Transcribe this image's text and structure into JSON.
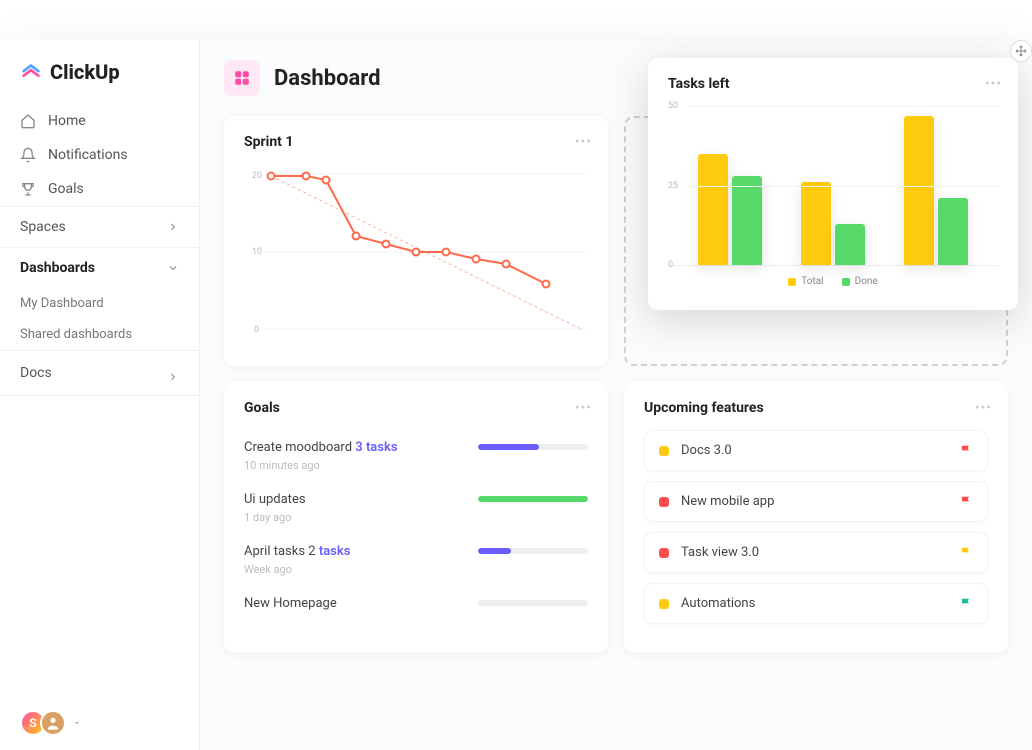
{
  "brand": "ClickUp",
  "nav": {
    "home": "Home",
    "notifications": "Notifications",
    "goals": "Goals"
  },
  "sections": {
    "spaces": "Spaces",
    "dashboards": "Dashboards",
    "docs": "Docs"
  },
  "dashboards_sub": {
    "my": "My Dashboard",
    "shared": "Shared dashboards"
  },
  "page": {
    "title": "Dashboard"
  },
  "sprint": {
    "title": "Sprint 1"
  },
  "tasks_left": {
    "title": "Tasks left",
    "legend_total": "Total",
    "legend_done": "Done"
  },
  "goals_card": {
    "title": "Goals",
    "items": [
      {
        "title_a": "Create moodboard ",
        "title_b": "3 tasks",
        "time": "10 minutes ago",
        "progress": 55,
        "color": "#6b5cff"
      },
      {
        "title_a": "Ui updates",
        "title_b": "",
        "time": "1 day ago",
        "progress": 100,
        "color": "#57d96a"
      },
      {
        "title_a": "April tasks 2 ",
        "title_b": "tasks",
        "time": "Week ago",
        "progress": 30,
        "color": "#6b5cff"
      },
      {
        "title_a": "New Homepage",
        "title_b": "",
        "time": "",
        "progress": 0,
        "color": "#ccc"
      }
    ]
  },
  "upcoming": {
    "title": "Upcoming features",
    "items": [
      {
        "label": "Docs 3.0",
        "dot": "#ffcb0f",
        "flag": "#ff4d4d"
      },
      {
        "label": "New mobile app",
        "dot": "#ff4d4d",
        "flag": "#ff4d4d"
      },
      {
        "label": "Task view 3.0",
        "dot": "#ff4d4d",
        "flag": "#ffcb0f"
      },
      {
        "label": "Automations",
        "dot": "#ffcb0f",
        "flag": "#1abc9c"
      }
    ]
  },
  "footer": {
    "avatar1": "S"
  },
  "colors": {
    "yellow": "#ffcb0f",
    "green": "#57d96a",
    "orange_line": "#ff6b4a"
  },
  "chart_data": [
    {
      "type": "line",
      "title": "Sprint 1",
      "x": [
        1,
        2,
        3,
        4,
        5,
        6,
        7,
        8,
        9,
        10
      ],
      "values": [
        20,
        20,
        19.5,
        12,
        11,
        10,
        10,
        9,
        8.5,
        6
      ],
      "ideal_start": 20,
      "ideal_end": 0,
      "ylim": [
        0,
        20
      ],
      "ylabel": "",
      "yticks": [
        0,
        10,
        20
      ]
    },
    {
      "type": "bar",
      "title": "Tasks left",
      "categories": [
        "",
        "",
        ""
      ],
      "series": [
        {
          "name": "Total",
          "values": [
            35,
            26,
            47
          ],
          "color": "#ffcb0f"
        },
        {
          "name": "Done",
          "values": [
            28,
            13,
            21
          ],
          "color": "#57d96a"
        }
      ],
      "ylim": [
        0,
        50
      ],
      "yticks": [
        0,
        25,
        50
      ]
    }
  ]
}
